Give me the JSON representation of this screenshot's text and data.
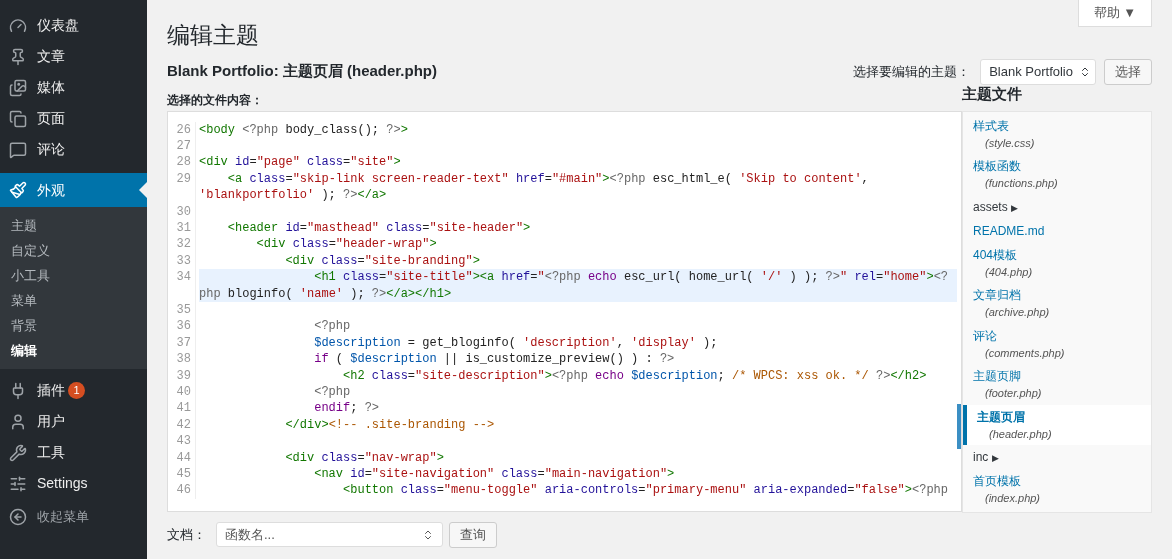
{
  "sidebar": {
    "items": [
      {
        "label": "仪表盘",
        "selected": false
      },
      {
        "label": "文章",
        "selected": false
      },
      {
        "label": "媒体",
        "selected": false
      },
      {
        "label": "页面",
        "selected": false
      },
      {
        "label": "评论",
        "selected": false
      },
      {
        "label": "外观",
        "selected": true,
        "submenu": [
          {
            "label": "主题",
            "selected": false
          },
          {
            "label": "自定义",
            "selected": false
          },
          {
            "label": "小工具",
            "selected": false
          },
          {
            "label": "菜单",
            "selected": false
          },
          {
            "label": "背景",
            "selected": false
          },
          {
            "label": "编辑",
            "selected": true
          }
        ]
      },
      {
        "label": "插件",
        "selected": false,
        "badge": "1"
      },
      {
        "label": "用户",
        "selected": false
      },
      {
        "label": "工具",
        "selected": false
      },
      {
        "label": "Settings",
        "selected": false
      }
    ],
    "collapse": "收起菜单"
  },
  "help_button": "帮助 ▼",
  "page_title": "编辑主题",
  "file_heading": "Blank Portfolio: 主题页眉 (header.php)",
  "theme_picker": {
    "label": "选择要编辑的主题：",
    "value": "Blank Portfolio",
    "button": "选择"
  },
  "editor": {
    "label": "选择的文件内容：",
    "lines": [
      {
        "number": "26",
        "current": false,
        "tokens": [
          {
            "kind": "tag",
            "text": "<body "
          },
          {
            "kind": "php",
            "text": "<?php "
          },
          {
            "kind": "plain",
            "text": "body_class(); "
          },
          {
            "kind": "php",
            "text": "?>"
          },
          {
            "kind": "tag",
            "text": ">"
          }
        ]
      },
      {
        "number": "27",
        "current": false
      },
      {
        "number": "28",
        "current": false,
        "tokens": [
          {
            "kind": "tag",
            "text": "<div "
          },
          {
            "kind": "attr",
            "text": "id"
          },
          {
            "kind": "plain",
            "text": "="
          },
          {
            "kind": "str",
            "text": "\"page\" "
          },
          {
            "kind": "attr",
            "text": "class"
          },
          {
            "kind": "plain",
            "text": "="
          },
          {
            "kind": "str",
            "text": "\"site\""
          },
          {
            "kind": "tag",
            "text": ">"
          }
        ]
      },
      {
        "number": "29",
        "current": false,
        "tokens": [
          {
            "kind": "tag",
            "text": "    <a "
          },
          {
            "kind": "attr",
            "text": "class"
          },
          {
            "kind": "plain",
            "text": "="
          },
          {
            "kind": "str",
            "text": "\"skip-link screen-reader-text\" "
          },
          {
            "kind": "attr",
            "text": "href"
          },
          {
            "kind": "plain",
            "text": "="
          },
          {
            "kind": "str",
            "text": "\"#main\""
          },
          {
            "kind": "tag",
            "text": ">"
          },
          {
            "kind": "php",
            "text": "<?php "
          },
          {
            "kind": "plain",
            "text": "esc_html_e( "
          },
          {
            "kind": "str",
            "text": "'Skip to content'"
          },
          {
            "kind": "plain",
            "text": ", "
          },
          {
            "kind": "str",
            "text": "'blankportfolio'"
          },
          {
            "kind": "plain",
            "text": " ); "
          },
          {
            "kind": "php",
            "text": "?>"
          },
          {
            "kind": "tag",
            "text": "</a>"
          }
        ]
      },
      {
        "number": "30",
        "current": false
      },
      {
        "number": "31",
        "current": false,
        "tokens": [
          {
            "kind": "tag",
            "text": "    <header "
          },
          {
            "kind": "attr",
            "text": "id"
          },
          {
            "kind": "plain",
            "text": "="
          },
          {
            "kind": "str",
            "text": "\"masthead\" "
          },
          {
            "kind": "attr",
            "text": "class"
          },
          {
            "kind": "plain",
            "text": "="
          },
          {
            "kind": "str",
            "text": "\"site-header\""
          },
          {
            "kind": "tag",
            "text": ">"
          }
        ]
      },
      {
        "number": "32",
        "current": false,
        "tokens": [
          {
            "kind": "tag",
            "text": "        <div "
          },
          {
            "kind": "attr",
            "text": "class"
          },
          {
            "kind": "plain",
            "text": "="
          },
          {
            "kind": "str",
            "text": "\"header-wrap\""
          },
          {
            "kind": "tag",
            "text": ">"
          }
        ]
      },
      {
        "number": "33",
        "current": false,
        "tokens": [
          {
            "kind": "tag",
            "text": "            <div "
          },
          {
            "kind": "attr",
            "text": "class"
          },
          {
            "kind": "plain",
            "text": "="
          },
          {
            "kind": "str",
            "text": "\"site-branding\""
          },
          {
            "kind": "tag",
            "text": ">"
          }
        ]
      },
      {
        "number": "34",
        "current": true,
        "tokens": [
          {
            "kind": "tag",
            "text": "                <h1 "
          },
          {
            "kind": "attr",
            "text": "class"
          },
          {
            "kind": "plain",
            "text": "="
          },
          {
            "kind": "str",
            "text": "\"site-title\""
          },
          {
            "kind": "tag",
            "text": "><a "
          },
          {
            "kind": "attr",
            "text": "href"
          },
          {
            "kind": "plain",
            "text": "="
          },
          {
            "kind": "str",
            "text": "\""
          },
          {
            "kind": "php",
            "text": "<?php "
          },
          {
            "kind": "kw",
            "text": "echo "
          },
          {
            "kind": "plain",
            "text": "esc_url( home_url( "
          },
          {
            "kind": "str",
            "text": "'/'"
          },
          {
            "kind": "plain",
            "text": " ) ); "
          },
          {
            "kind": "php",
            "text": "?>"
          },
          {
            "kind": "str",
            "text": "\" "
          },
          {
            "kind": "attr",
            "text": "rel"
          },
          {
            "kind": "plain",
            "text": "="
          },
          {
            "kind": "str",
            "text": "\"home\""
          },
          {
            "kind": "tag",
            "text": ">"
          },
          {
            "kind": "php",
            "text": "<?php "
          },
          {
            "kind": "plain",
            "text": "bloginfo( "
          },
          {
            "kind": "str",
            "text": "'name'"
          },
          {
            "kind": "plain",
            "text": " ); "
          },
          {
            "kind": "php",
            "text": "?>"
          },
          {
            "kind": "tag",
            "text": "</a></h1>"
          }
        ]
      },
      {
        "number": "35",
        "current": false
      },
      {
        "number": "36",
        "current": false,
        "tokens": [
          {
            "kind": "php",
            "text": "                <?php"
          }
        ]
      },
      {
        "number": "37",
        "current": false,
        "tokens": [
          {
            "kind": "var",
            "text": "                $description"
          },
          {
            "kind": "plain",
            "text": " = get_bloginfo( "
          },
          {
            "kind": "str",
            "text": "'description'"
          },
          {
            "kind": "plain",
            "text": ", "
          },
          {
            "kind": "str",
            "text": "'display'"
          },
          {
            "kind": "plain",
            "text": " );"
          }
        ]
      },
      {
        "number": "38",
        "current": false,
        "tokens": [
          {
            "kind": "kw",
            "text": "                if"
          },
          {
            "kind": "plain",
            "text": " ( "
          },
          {
            "kind": "var",
            "text": "$description"
          },
          {
            "kind": "plain",
            "text": " || is_customize_preview() ) : "
          },
          {
            "kind": "php",
            "text": "?>"
          }
        ]
      },
      {
        "number": "39",
        "current": false,
        "tokens": [
          {
            "kind": "tag",
            "text": "                    <h2 "
          },
          {
            "kind": "attr",
            "text": "class"
          },
          {
            "kind": "plain",
            "text": "="
          },
          {
            "kind": "str",
            "text": "\"site-description\""
          },
          {
            "kind": "tag",
            "text": ">"
          },
          {
            "kind": "php",
            "text": "<?php "
          },
          {
            "kind": "kw",
            "text": "echo "
          },
          {
            "kind": "var",
            "text": "$description"
          },
          {
            "kind": "plain",
            "text": "; "
          },
          {
            "kind": "comment",
            "text": "/* WPCS: xss ok. */ "
          },
          {
            "kind": "php",
            "text": "?>"
          },
          {
            "kind": "tag",
            "text": "</h2>"
          }
        ]
      },
      {
        "number": "40",
        "current": false,
        "tokens": [
          {
            "kind": "php",
            "text": "                <?php"
          }
        ]
      },
      {
        "number": "41",
        "current": false,
        "tokens": [
          {
            "kind": "kw",
            "text": "                endif"
          },
          {
            "kind": "plain",
            "text": "; "
          },
          {
            "kind": "php",
            "text": "?>"
          }
        ]
      },
      {
        "number": "42",
        "current": false,
        "tokens": [
          {
            "kind": "tag",
            "text": "            </div>"
          },
          {
            "kind": "comment",
            "text": "<!-- .site-branding -->"
          }
        ]
      },
      {
        "number": "43",
        "current": false
      },
      {
        "number": "44",
        "current": false,
        "tokens": [
          {
            "kind": "tag",
            "text": "            <div "
          },
          {
            "kind": "attr",
            "text": "class"
          },
          {
            "kind": "plain",
            "text": "="
          },
          {
            "kind": "str",
            "text": "\"nav-wrap\""
          },
          {
            "kind": "tag",
            "text": ">"
          }
        ]
      },
      {
        "number": "45",
        "current": false,
        "tokens": [
          {
            "kind": "tag",
            "text": "                <nav "
          },
          {
            "kind": "attr",
            "text": "id"
          },
          {
            "kind": "plain",
            "text": "="
          },
          {
            "kind": "str",
            "text": "\"site-navigation\" "
          },
          {
            "kind": "attr",
            "text": "class"
          },
          {
            "kind": "plain",
            "text": "="
          },
          {
            "kind": "str",
            "text": "\"main-navigation\""
          },
          {
            "kind": "tag",
            "text": ">"
          }
        ]
      },
      {
        "number": "46",
        "current": false,
        "tokens": [
          {
            "kind": "tag",
            "text": "                    <button "
          },
          {
            "kind": "attr",
            "text": "class"
          },
          {
            "kind": "plain",
            "text": "="
          },
          {
            "kind": "str",
            "text": "\"menu-toggle\" "
          },
          {
            "kind": "attr",
            "text": "aria-controls"
          },
          {
            "kind": "plain",
            "text": "="
          },
          {
            "kind": "str",
            "text": "\"primary-menu\" "
          },
          {
            "kind": "attr",
            "text": "aria-expanded"
          },
          {
            "kind": "plain",
            "text": "="
          },
          {
            "kind": "str",
            "text": "\"false\""
          },
          {
            "kind": "tag",
            "text": ">"
          },
          {
            "kind": "php",
            "text": "<?php"
          }
        ]
      }
    ]
  },
  "docs": {
    "label": "文档：",
    "placeholder": "函数名...",
    "button": "查询"
  },
  "theme_files": {
    "title": "主题文件",
    "items": [
      {
        "kind": "file",
        "label": "样式表",
        "file": "(style.css)",
        "selected": false
      },
      {
        "kind": "file",
        "label": "模板函数",
        "file": "(functions.php)",
        "selected": false
      },
      {
        "kind": "folder",
        "label": "assets",
        "arrow": "▶",
        "selected": false
      },
      {
        "kind": "file",
        "label": "README.md",
        "selected": false
      },
      {
        "kind": "file",
        "label": "404模板",
        "file": "(404.php)",
        "selected": false
      },
      {
        "kind": "file",
        "label": "文章归档",
        "file": "(archive.php)",
        "selected": false
      },
      {
        "kind": "file",
        "label": "评论",
        "file": "(comments.php)",
        "selected": false
      },
      {
        "kind": "file",
        "label": "主题页脚",
        "file": "(footer.php)",
        "selected": false
      },
      {
        "kind": "file",
        "label": "主题页眉",
        "file": "(header.php)",
        "selected": true
      },
      {
        "kind": "folder",
        "label": "inc",
        "arrow": "▶",
        "selected": false
      },
      {
        "kind": "file",
        "label": "首页模板",
        "file": "(index.php)",
        "selected": false
      }
    ]
  }
}
